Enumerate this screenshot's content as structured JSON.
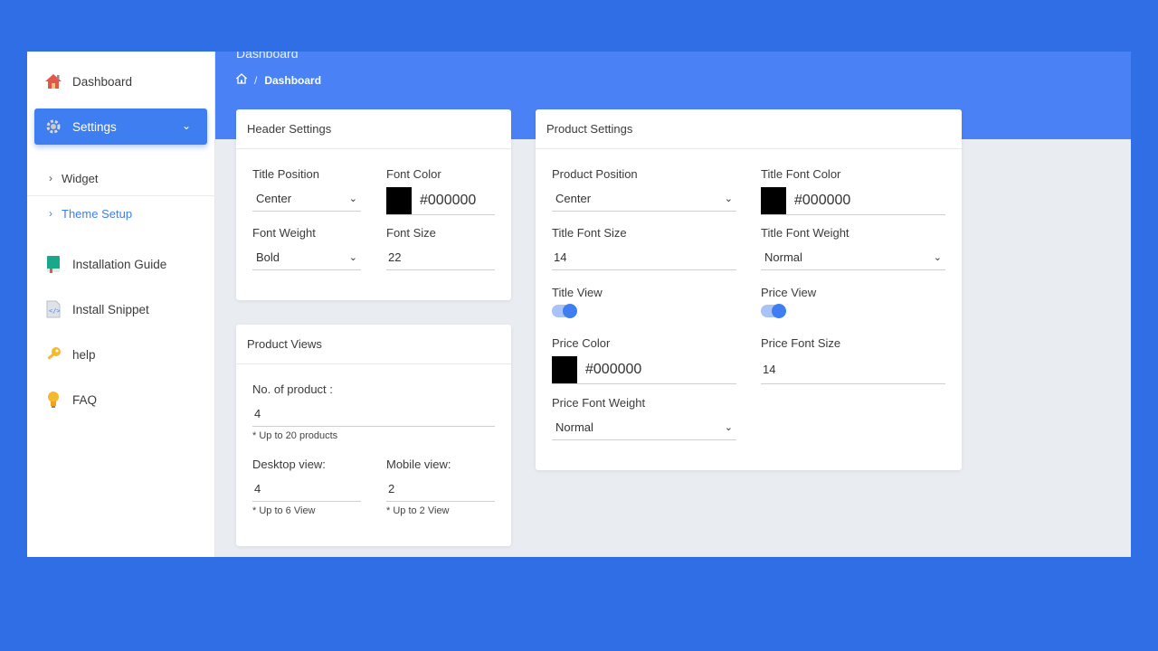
{
  "colors": {
    "accent": "#3f7ef0",
    "background": "#2f6ee5",
    "header": "#4a82f6",
    "swatch": "#000000"
  },
  "sidebar": {
    "items": [
      {
        "label": "Dashboard",
        "icon": "home-icon"
      },
      {
        "label": "Settings",
        "icon": "gear-icon"
      },
      {
        "label": "Installation Guide",
        "icon": "book-icon"
      },
      {
        "label": "Install Snippet",
        "icon": "code-file-icon"
      },
      {
        "label": "help",
        "icon": "key-icon"
      },
      {
        "label": "FAQ",
        "icon": "lightbulb-icon"
      }
    ],
    "submenu": [
      {
        "label": "Widget"
      },
      {
        "label": "Theme Setup"
      }
    ]
  },
  "header": {
    "title": "Dashboard",
    "breadcrumb": {
      "sep": "/",
      "current": "Dashboard"
    }
  },
  "header_settings": {
    "title": "Header Settings",
    "title_position": {
      "label": "Title Position",
      "value": "Center"
    },
    "font_color": {
      "label": "Font Color",
      "value": "#000000"
    },
    "font_weight": {
      "label": "Font Weight",
      "value": "Bold"
    },
    "font_size": {
      "label": "Font Size",
      "value": "22"
    }
  },
  "product_views": {
    "title": "Product Views",
    "no_of_product": {
      "label": "No. of product :",
      "value": "4",
      "hint": "* Up to 20 products"
    },
    "desktop_view": {
      "label": "Desktop view:",
      "value": "4",
      "hint": "* Up to 6 View"
    },
    "mobile_view": {
      "label": "Mobile view:",
      "value": "2",
      "hint": "* Up to 2 View"
    }
  },
  "product_settings": {
    "title": "Product Settings",
    "product_position": {
      "label": "Product Position",
      "value": "Center"
    },
    "title_font_color": {
      "label": "Title Font Color",
      "value": "#000000"
    },
    "title_font_size": {
      "label": "Title Font Size",
      "value": "14"
    },
    "title_font_weight": {
      "label": "Title Font Weight",
      "value": "Normal"
    },
    "title_view": {
      "label": "Title View",
      "enabled": true
    },
    "price_view": {
      "label": "Price View",
      "enabled": true
    },
    "price_color": {
      "label": "Price Color",
      "value": "#000000"
    },
    "price_font_size": {
      "label": "Price Font Size",
      "value": "14"
    },
    "price_font_weight": {
      "label": "Price Font Weight",
      "value": "Normal"
    }
  }
}
